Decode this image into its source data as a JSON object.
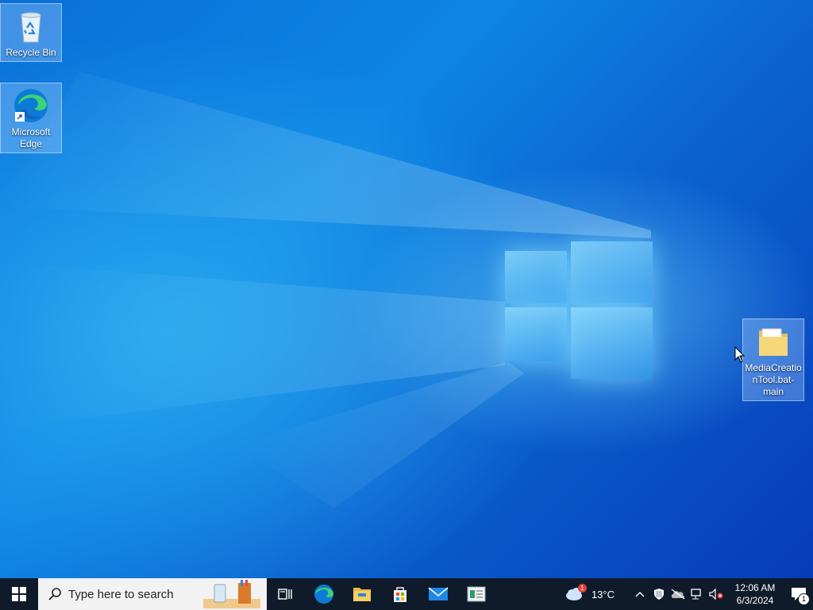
{
  "desktop": {
    "icons": [
      {
        "label": "Recycle Bin",
        "icon": "recycle-bin-icon"
      },
      {
        "label": "Microsoft Edge",
        "icon": "edge-icon"
      },
      {
        "label": "MediaCreationTool.bat-main",
        "icon": "folder-icon"
      }
    ]
  },
  "taskbar": {
    "start_icon": "windows-start-icon",
    "search_placeholder": "Type here to search",
    "pinned": [
      "task-view-icon",
      "edge-icon",
      "file-explorer-icon",
      "microsoft-store-icon",
      "mail-icon",
      "app-icon"
    ],
    "weather": {
      "temperature": "13°C",
      "badge": "1"
    },
    "clock": {
      "time": "12:06 AM",
      "date": "6/3/2024"
    },
    "notifications": {
      "count": "1"
    }
  },
  "colors": {
    "taskbar": "#0f1b2a",
    "accent": "#0a6fd8"
  }
}
